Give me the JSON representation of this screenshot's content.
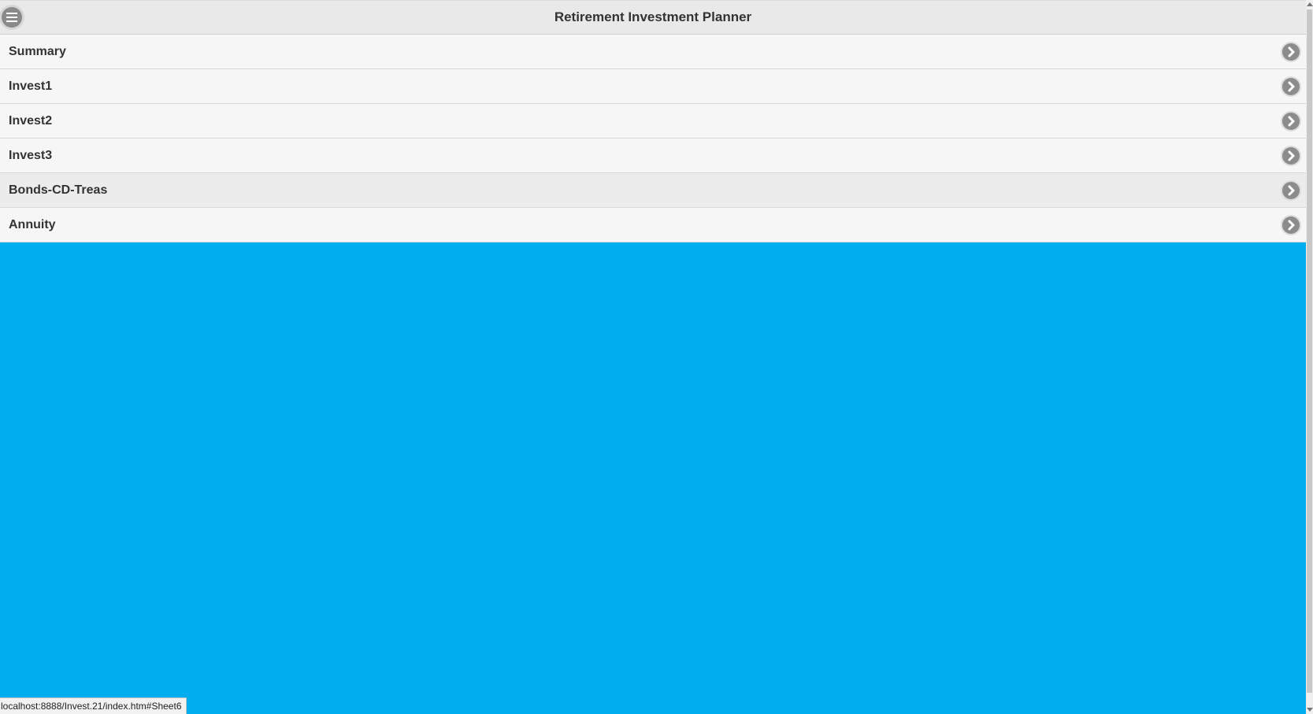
{
  "header": {
    "title": "Retirement Investment Planner",
    "menu_icon": "hamburger-menu-icon"
  },
  "list": {
    "items": [
      {
        "label": "Summary",
        "icon": "chevron-right-icon"
      },
      {
        "label": "Invest1",
        "icon": "chevron-right-icon"
      },
      {
        "label": "Invest2",
        "icon": "chevron-right-icon"
      },
      {
        "label": "Invest3",
        "icon": "chevron-right-icon"
      },
      {
        "label": "Bonds-CD-Treas",
        "icon": "chevron-right-icon"
      },
      {
        "label": "Annuity",
        "icon": "chevron-right-icon"
      }
    ]
  },
  "status_bar": {
    "url": "localhost:8888/Invest.21/index.htm#Sheet6"
  },
  "colors": {
    "background": "#00aeef",
    "header_bg": "#e9e9e9",
    "list_bg": "#f6f6f6",
    "hover_bg": "#ececec",
    "icon_gray": "#8c8c8c"
  }
}
